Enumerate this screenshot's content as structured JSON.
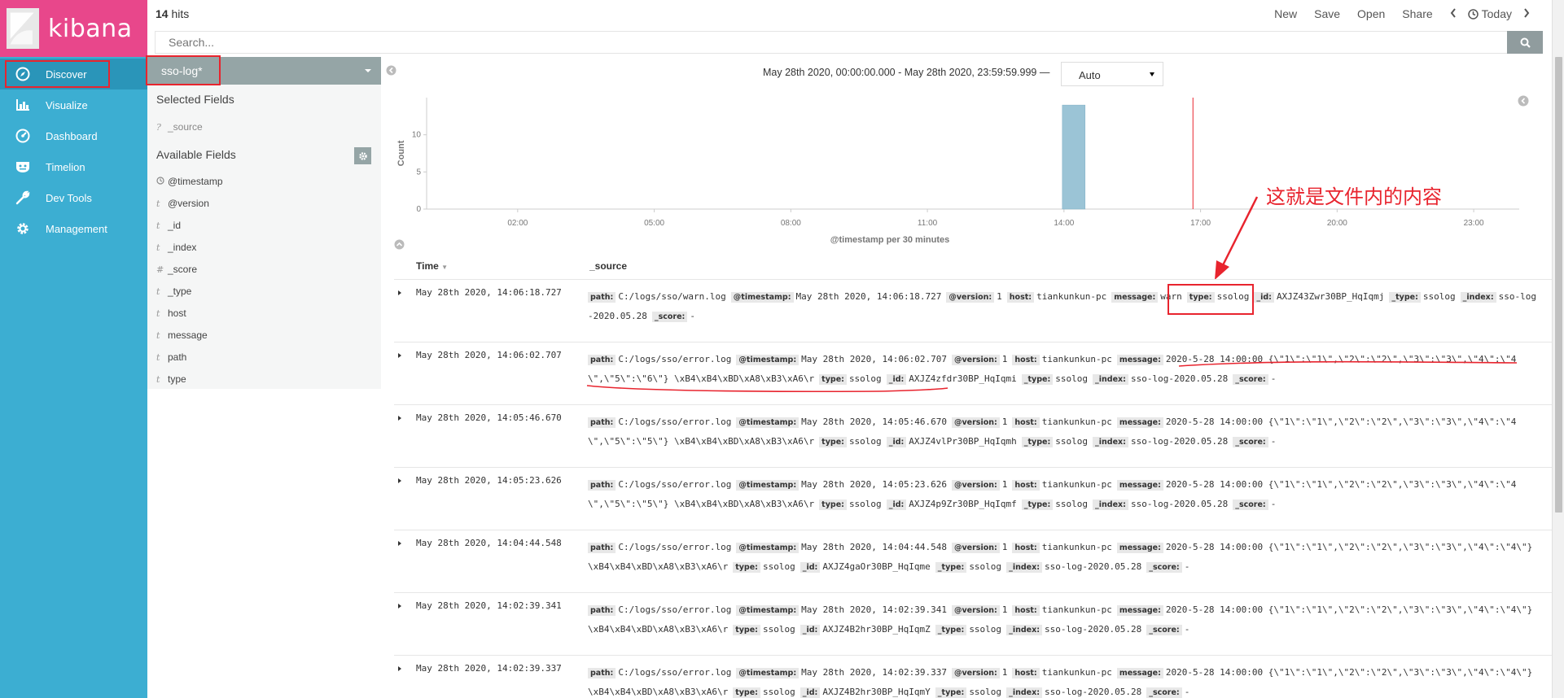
{
  "app": {
    "name": "kibana"
  },
  "nav": {
    "items": [
      {
        "label": "Discover",
        "icon": "compass-icon"
      },
      {
        "label": "Visualize",
        "icon": "bar-chart-icon"
      },
      {
        "label": "Dashboard",
        "icon": "gauge-icon"
      },
      {
        "label": "Timelion",
        "icon": "shield-face-icon"
      },
      {
        "label": "Dev Tools",
        "icon": "wrench-icon"
      },
      {
        "label": "Management",
        "icon": "gear-icon"
      }
    ]
  },
  "top": {
    "hits_count": "14",
    "hits_label": "hits",
    "links": [
      "New",
      "Save",
      "Open",
      "Share"
    ],
    "time_label": "Today"
  },
  "search": {
    "placeholder": "Search..."
  },
  "sidebar": {
    "index_pattern": "sso-log*",
    "selected_title": "Selected Fields",
    "selected_fields": [
      {
        "type": "?",
        "name": "_source"
      }
    ],
    "available_title": "Available Fields",
    "available_fields": [
      {
        "type": "clock",
        "name": "@timestamp"
      },
      {
        "type": "t",
        "name": "@version"
      },
      {
        "type": "t",
        "name": "_id"
      },
      {
        "type": "t",
        "name": "_index"
      },
      {
        "type": "#",
        "name": "_score"
      },
      {
        "type": "t",
        "name": "_type"
      },
      {
        "type": "t",
        "name": "host"
      },
      {
        "type": "t",
        "name": "message"
      },
      {
        "type": "t",
        "name": "path"
      },
      {
        "type": "t",
        "name": "type"
      }
    ]
  },
  "histogram": {
    "date_range": "May 28th 2020, 00:00:00.000 - May 28th 2020, 23:59:59.999 —",
    "interval": "Auto",
    "annotation": "这就是文件内的内容"
  },
  "chart_data": {
    "type": "bar",
    "x": [
      "14:00"
    ],
    "values": [
      14
    ],
    "ylabel": "Count",
    "xlabel": "@timestamp per 30 minutes",
    "x_ticks": [
      "02:00",
      "05:00",
      "08:00",
      "11:00",
      "14:00",
      "17:00",
      "20:00",
      "23:00"
    ],
    "y_ticks": [
      "0",
      "5",
      "10"
    ],
    "ylim": [
      0,
      15
    ],
    "bar_color": "#9bc4d6",
    "now_marker": "16:50",
    "marker_color": "#e8242e"
  },
  "table": {
    "col_time": "Time",
    "col_source": "_source",
    "rows": [
      {
        "time": "May 28th 2020, 14:06:18.727",
        "fields": [
          [
            "path:",
            "C:/logs/sso/warn.log"
          ],
          [
            "@timestamp:",
            "May 28th 2020, 14:06:18.727"
          ],
          [
            "@version:",
            "1"
          ],
          [
            "host:",
            "tiankunkun-pc"
          ],
          [
            "message:",
            "warn"
          ],
          [
            "type:",
            "ssolog"
          ],
          [
            "_id:",
            "AXJZ43Zwr30BP_HqIqmj"
          ],
          [
            "_type:",
            "ssolog"
          ],
          [
            "_index:",
            "sso-log-2020.05.28"
          ],
          [
            "_score:",
            "-"
          ]
        ]
      },
      {
        "time": "May 28th 2020, 14:06:02.707",
        "fields": [
          [
            "path:",
            "C:/logs/sso/error.log"
          ],
          [
            "@timestamp:",
            "May 28th 2020, 14:06:02.707"
          ],
          [
            "@version:",
            "1"
          ],
          [
            "host:",
            "tiankunkun-pc"
          ],
          [
            "message:",
            "2020-5-28 14:00:00 {\\\"1\\\":\\\"1\\\",\\\"2\\\":\\\"2\\\",\\\"3\\\":\\\"3\\\",\\\"4\\\":\\\"4\\\",\\\"5\\\":\\\"6\\\"} \\xB4\\xB4\\xBD\\xA8\\xB3\\xA6\\r"
          ],
          [
            "type:",
            "ssolog"
          ],
          [
            "_id:",
            "AXJZ4zfdr30BP_HqIqmi"
          ],
          [
            "_type:",
            "ssolog"
          ],
          [
            "_index:",
            "sso-log-2020.05.28"
          ],
          [
            "_score:",
            "-"
          ]
        ]
      },
      {
        "time": "May 28th 2020, 14:05:46.670",
        "fields": [
          [
            "path:",
            "C:/logs/sso/error.log"
          ],
          [
            "@timestamp:",
            "May 28th 2020, 14:05:46.670"
          ],
          [
            "@version:",
            "1"
          ],
          [
            "host:",
            "tiankunkun-pc"
          ],
          [
            "message:",
            "2020-5-28 14:00:00 {\\\"1\\\":\\\"1\\\",\\\"2\\\":\\\"2\\\",\\\"3\\\":\\\"3\\\",\\\"4\\\":\\\"4\\\",\\\"5\\\":\\\"5\\\"} \\xB4\\xB4\\xBD\\xA8\\xB3\\xA6\\r"
          ],
          [
            "type:",
            "ssolog"
          ],
          [
            "_id:",
            "AXJZ4vlPr30BP_HqIqmh"
          ],
          [
            "_type:",
            "ssolog"
          ],
          [
            "_index:",
            "sso-log-2020.05.28"
          ],
          [
            "_score:",
            "-"
          ]
        ]
      },
      {
        "time": "May 28th 2020, 14:05:23.626",
        "fields": [
          [
            "path:",
            "C:/logs/sso/error.log"
          ],
          [
            "@timestamp:",
            "May 28th 2020, 14:05:23.626"
          ],
          [
            "@version:",
            "1"
          ],
          [
            "host:",
            "tiankunkun-pc"
          ],
          [
            "message:",
            "2020-5-28 14:00:00 {\\\"1\\\":\\\"1\\\",\\\"2\\\":\\\"2\\\",\\\"3\\\":\\\"3\\\",\\\"4\\\":\\\"4\\\",\\\"5\\\":\\\"5\\\"} \\xB4\\xB4\\xBD\\xA8\\xB3\\xA6\\r"
          ],
          [
            "type:",
            "ssolog"
          ],
          [
            "_id:",
            "AXJZ4p9Zr30BP_HqIqmf"
          ],
          [
            "_type:",
            "ssolog"
          ],
          [
            "_index:",
            "sso-log-2020.05.28"
          ],
          [
            "_score:",
            "-"
          ]
        ]
      },
      {
        "time": "May 28th 2020, 14:04:44.548",
        "fields": [
          [
            "path:",
            "C:/logs/sso/error.log"
          ],
          [
            "@timestamp:",
            "May 28th 2020, 14:04:44.548"
          ],
          [
            "@version:",
            "1"
          ],
          [
            "host:",
            "tiankunkun-pc"
          ],
          [
            "message:",
            "2020-5-28 14:00:00 {\\\"1\\\":\\\"1\\\",\\\"2\\\":\\\"2\\\",\\\"3\\\":\\\"3\\\",\\\"4\\\":\\\"4\\\"} \\xB4\\xB4\\xBD\\xA8\\xB3\\xA6\\r"
          ],
          [
            "type:",
            "ssolog"
          ],
          [
            "_id:",
            "AXJZ4gaOr30BP_HqIqme"
          ],
          [
            "_type:",
            "ssolog"
          ],
          [
            "_index:",
            "sso-log-2020.05.28"
          ],
          [
            "_score:",
            "-"
          ]
        ]
      },
      {
        "time": "May 28th 2020, 14:02:39.341",
        "fields": [
          [
            "path:",
            "C:/logs/sso/error.log"
          ],
          [
            "@timestamp:",
            "May 28th 2020, 14:02:39.341"
          ],
          [
            "@version:",
            "1"
          ],
          [
            "host:",
            "tiankunkun-pc"
          ],
          [
            "message:",
            "2020-5-28 14:00:00 {\\\"1\\\":\\\"1\\\",\\\"2\\\":\\\"2\\\",\\\"3\\\":\\\"3\\\",\\\"4\\\":\\\"4\\\"} \\xB4\\xB4\\xBD\\xA8\\xB3\\xA6\\r"
          ],
          [
            "type:",
            "ssolog"
          ],
          [
            "_id:",
            "AXJZ4B2hr30BP_HqIqmZ"
          ],
          [
            "_type:",
            "ssolog"
          ],
          [
            "_index:",
            "sso-log-2020.05.28"
          ],
          [
            "_score:",
            "-"
          ]
        ]
      },
      {
        "time": "May 28th 2020, 14:02:39.337",
        "fields": [
          [
            "path:",
            "C:/logs/sso/error.log"
          ],
          [
            "@timestamp:",
            "May 28th 2020, 14:02:39.337"
          ],
          [
            "@version:",
            "1"
          ],
          [
            "host:",
            "tiankunkun-pc"
          ],
          [
            "message:",
            "2020-5-28 14:00:00 {\\\"1\\\":\\\"1\\\",\\\"2\\\":\\\"2\\\",\\\"3\\\":\\\"3\\\",\\\"4\\\":\\\"4\\\"} \\xB4\\xB4\\xBD\\xA8\\xB3\\xA6\\r"
          ],
          [
            "type:",
            "ssolog"
          ],
          [
            "_id:",
            "AXJZ4B2hr30BP_HqIqmY"
          ],
          [
            "_type:",
            "ssolog"
          ],
          [
            "_index:",
            "sso-log-2020.05.28"
          ],
          [
            "_score:",
            "-"
          ]
        ]
      }
    ]
  }
}
